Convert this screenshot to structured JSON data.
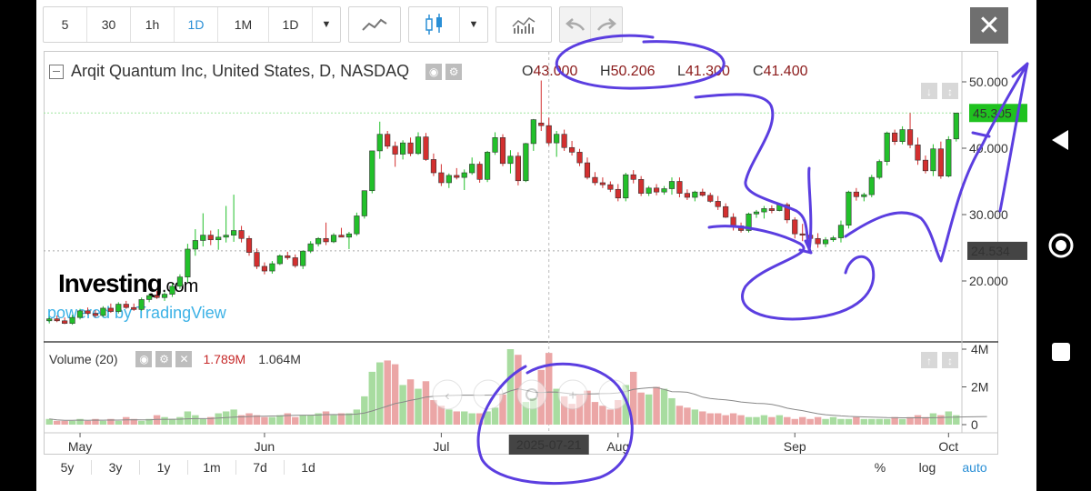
{
  "toolbar": {
    "intervals": [
      "5",
      "30",
      "1h",
      "1D",
      "1M",
      "1D"
    ],
    "active_interval": "1D"
  },
  "header": {
    "title": "Arqit Quantum Inc, United States, D, NASDAQ",
    "o_label": "O",
    "o_value": "43.000",
    "h_label": "H",
    "h_value": "50.206",
    "l_label": "L",
    "l_value": "41.300",
    "c_label": "C",
    "c_value": "41.400"
  },
  "volume_legend": {
    "title": "Volume (20)",
    "value1": "1.789M",
    "value2": "1.064M"
  },
  "watermark": {
    "logo": "Investing",
    "logo_suffix": ".com",
    "powered": "powered by TradingView"
  },
  "crosshair_date": "2025-07-21",
  "bottom_ranges": [
    "5y",
    "3y",
    "1y",
    "1m",
    "7d",
    "1d"
  ],
  "bottom_right": [
    "%",
    "log",
    "auto"
  ],
  "colors": {
    "up": "#22c02a",
    "down": "#d32f2f",
    "up_volume": "#a8dca0",
    "down_volume": "#eba6a6",
    "last_price_label": "#1fc21f",
    "marker_label": "#444444",
    "annotation": "#5b3ee0"
  },
  "chart_data": {
    "type": "candlestick",
    "y_axis": {
      "range": [
        10,
        55
      ],
      "ticks": [
        "50.000",
        "40.000",
        "30.000",
        "20.000"
      ],
      "tick_values": [
        50,
        40,
        30,
        20
      ]
    },
    "volume_axis": {
      "ticks": [
        "4M",
        "2M",
        "0"
      ],
      "tick_values": [
        4,
        2,
        0
      ],
      "unit": "M"
    },
    "x_ticks": [
      "May",
      "Jun",
      "Jul",
      "Aug",
      "Sep",
      "Oct"
    ],
    "last_price": "45.305",
    "last_value": 45.305,
    "marker_price": "24.534",
    "marker_value": 24.534,
    "candles": [
      {
        "o": 14.0,
        "h": 14.6,
        "l": 13.6,
        "c": 14.3
      },
      {
        "o": 14.3,
        "h": 14.8,
        "l": 13.8,
        "c": 14.0
      },
      {
        "o": 14.0,
        "h": 14.5,
        "l": 13.5,
        "c": 13.6
      },
      {
        "o": 13.6,
        "h": 14.9,
        "l": 13.4,
        "c": 14.5
      },
      {
        "o": 14.5,
        "h": 15.8,
        "l": 14.2,
        "c": 15.5
      },
      {
        "o": 15.5,
        "h": 16.0,
        "l": 14.9,
        "c": 15.1
      },
      {
        "o": 15.1,
        "h": 15.6,
        "l": 14.5,
        "c": 14.8
      },
      {
        "o": 14.8,
        "h": 16.2,
        "l": 14.6,
        "c": 15.9
      },
      {
        "o": 15.9,
        "h": 16.6,
        "l": 15.2,
        "c": 15.4
      },
      {
        "o": 15.4,
        "h": 16.8,
        "l": 15.1,
        "c": 16.5
      },
      {
        "o": 16.5,
        "h": 17.0,
        "l": 15.8,
        "c": 16.0
      },
      {
        "o": 16.0,
        "h": 16.6,
        "l": 15.5,
        "c": 15.7
      },
      {
        "o": 15.7,
        "h": 17.5,
        "l": 15.5,
        "c": 17.2
      },
      {
        "o": 17.2,
        "h": 18.0,
        "l": 16.8,
        "c": 17.8
      },
      {
        "o": 17.8,
        "h": 18.5,
        "l": 17.3,
        "c": 17.5
      },
      {
        "o": 17.5,
        "h": 18.3,
        "l": 17.0,
        "c": 18.0
      },
      {
        "o": 18.0,
        "h": 19.6,
        "l": 17.6,
        "c": 19.2
      },
      {
        "o": 19.2,
        "h": 21.0,
        "l": 18.8,
        "c": 20.6
      },
      {
        "o": 20.6,
        "h": 25.6,
        "l": 19.8,
        "c": 24.8
      },
      {
        "o": 24.8,
        "h": 27.8,
        "l": 23.8,
        "c": 26.1
      },
      {
        "o": 26.1,
        "h": 30.2,
        "l": 25.2,
        "c": 26.9
      },
      {
        "o": 26.9,
        "h": 27.6,
        "l": 25.4,
        "c": 26.2
      },
      {
        "o": 26.2,
        "h": 27.8,
        "l": 24.7,
        "c": 26.6
      },
      {
        "o": 26.6,
        "h": 31.3,
        "l": 25.8,
        "c": 26.9
      },
      {
        "o": 26.9,
        "h": 33.0,
        "l": 25.9,
        "c": 27.6
      },
      {
        "o": 27.6,
        "h": 28.3,
        "l": 25.8,
        "c": 26.4
      },
      {
        "o": 26.4,
        "h": 26.8,
        "l": 23.8,
        "c": 24.3
      },
      {
        "o": 24.3,
        "h": 24.9,
        "l": 21.8,
        "c": 22.2
      },
      {
        "o": 22.2,
        "h": 22.8,
        "l": 21.0,
        "c": 21.5
      },
      {
        "o": 21.5,
        "h": 23.0,
        "l": 21.1,
        "c": 22.6
      },
      {
        "o": 22.6,
        "h": 24.0,
        "l": 22.4,
        "c": 23.8
      },
      {
        "o": 23.8,
        "h": 24.4,
        "l": 23.2,
        "c": 23.5
      },
      {
        "o": 23.5,
        "h": 24.0,
        "l": 22.0,
        "c": 22.3
      },
      {
        "o": 22.3,
        "h": 24.6,
        "l": 21.8,
        "c": 24.5
      },
      {
        "o": 24.5,
        "h": 26.0,
        "l": 24.2,
        "c": 25.6
      },
      {
        "o": 25.6,
        "h": 26.6,
        "l": 25.2,
        "c": 26.4
      },
      {
        "o": 26.4,
        "h": 28.8,
        "l": 25.4,
        "c": 25.9
      },
      {
        "o": 25.9,
        "h": 27.2,
        "l": 25.7,
        "c": 26.9
      },
      {
        "o": 26.9,
        "h": 28.0,
        "l": 26.6,
        "c": 26.6
      },
      {
        "o": 26.6,
        "h": 27.4,
        "l": 24.8,
        "c": 27.1
      },
      {
        "o": 27.1,
        "h": 30.3,
        "l": 26.8,
        "c": 29.8
      },
      {
        "o": 29.8,
        "h": 33.6,
        "l": 29.4,
        "c": 33.6
      },
      {
        "o": 33.6,
        "h": 39.6,
        "l": 33.2,
        "c": 39.6
      },
      {
        "o": 39.6,
        "h": 44.0,
        "l": 38.4,
        "c": 42.1
      },
      {
        "o": 42.1,
        "h": 42.6,
        "l": 39.9,
        "c": 40.3
      },
      {
        "o": 40.3,
        "h": 41.0,
        "l": 37.2,
        "c": 39.1
      },
      {
        "o": 39.1,
        "h": 41.2,
        "l": 38.3,
        "c": 40.8
      },
      {
        "o": 40.8,
        "h": 41.6,
        "l": 38.8,
        "c": 39.2
      },
      {
        "o": 39.2,
        "h": 42.4,
        "l": 39.0,
        "c": 41.7
      },
      {
        "o": 41.7,
        "h": 42.3,
        "l": 38.1,
        "c": 38.3
      },
      {
        "o": 38.3,
        "h": 39.2,
        "l": 35.8,
        "c": 36.3
      },
      {
        "o": 36.3,
        "h": 37.6,
        "l": 34.3,
        "c": 34.8
      },
      {
        "o": 34.8,
        "h": 36.2,
        "l": 34.0,
        "c": 35.9
      },
      {
        "o": 35.9,
        "h": 37.0,
        "l": 35.3,
        "c": 35.6
      },
      {
        "o": 35.6,
        "h": 36.8,
        "l": 33.7,
        "c": 36.3
      },
      {
        "o": 36.3,
        "h": 38.6,
        "l": 36.0,
        "c": 37.6
      },
      {
        "o": 37.6,
        "h": 38.0,
        "l": 34.8,
        "c": 35.3
      },
      {
        "o": 35.3,
        "h": 39.6,
        "l": 34.9,
        "c": 39.4
      },
      {
        "o": 39.4,
        "h": 42.4,
        "l": 39.0,
        "c": 41.6
      },
      {
        "o": 41.6,
        "h": 42.1,
        "l": 37.3,
        "c": 37.7
      },
      {
        "o": 37.7,
        "h": 39.7,
        "l": 36.2,
        "c": 38.8
      },
      {
        "o": 38.8,
        "h": 39.4,
        "l": 34.4,
        "c": 35.1
      },
      {
        "o": 35.1,
        "h": 40.8,
        "l": 34.9,
        "c": 40.7
      },
      {
        "o": 40.7,
        "h": 44.4,
        "l": 39.6,
        "c": 44.3
      },
      {
        "o": 43.8,
        "h": 50.2,
        "l": 42.6,
        "c": 43.4
      },
      {
        "o": 43.4,
        "h": 44.6,
        "l": 40.4,
        "c": 40.8
      },
      {
        "o": 40.8,
        "h": 42.6,
        "l": 38.7,
        "c": 42.1
      },
      {
        "o": 42.1,
        "h": 42.8,
        "l": 39.6,
        "c": 40.1
      },
      {
        "o": 40.1,
        "h": 41.1,
        "l": 38.9,
        "c": 39.4
      },
      {
        "o": 39.4,
        "h": 39.9,
        "l": 37.3,
        "c": 37.8
      },
      {
        "o": 37.8,
        "h": 38.6,
        "l": 35.3,
        "c": 35.6
      },
      {
        "o": 35.6,
        "h": 36.4,
        "l": 34.4,
        "c": 34.8
      },
      {
        "o": 34.8,
        "h": 35.6,
        "l": 34.0,
        "c": 34.5
      },
      {
        "o": 34.5,
        "h": 35.0,
        "l": 33.4,
        "c": 33.8
      },
      {
        "o": 33.8,
        "h": 34.6,
        "l": 32.0,
        "c": 32.5
      },
      {
        "o": 32.5,
        "h": 36.3,
        "l": 32.0,
        "c": 36.0
      },
      {
        "o": 36.0,
        "h": 36.7,
        "l": 34.7,
        "c": 35.3
      },
      {
        "o": 35.3,
        "h": 35.8,
        "l": 32.8,
        "c": 33.2
      },
      {
        "o": 33.2,
        "h": 34.3,
        "l": 32.8,
        "c": 34.0
      },
      {
        "o": 34.0,
        "h": 34.6,
        "l": 32.9,
        "c": 33.4
      },
      {
        "o": 33.4,
        "h": 34.3,
        "l": 33.0,
        "c": 33.9
      },
      {
        "o": 33.9,
        "h": 35.6,
        "l": 33.0,
        "c": 35.0
      },
      {
        "o": 35.0,
        "h": 35.6,
        "l": 32.6,
        "c": 33.2
      },
      {
        "o": 33.2,
        "h": 33.8,
        "l": 32.2,
        "c": 32.6
      },
      {
        "o": 32.6,
        "h": 33.6,
        "l": 32.0,
        "c": 33.4
      },
      {
        "o": 33.4,
        "h": 33.9,
        "l": 32.7,
        "c": 32.9
      },
      {
        "o": 32.9,
        "h": 33.3,
        "l": 31.8,
        "c": 32.0
      },
      {
        "o": 32.0,
        "h": 32.8,
        "l": 30.7,
        "c": 31.2
      },
      {
        "o": 31.2,
        "h": 31.7,
        "l": 29.5,
        "c": 29.6
      },
      {
        "o": 29.6,
        "h": 30.2,
        "l": 27.6,
        "c": 28.3
      },
      {
        "o": 28.3,
        "h": 28.8,
        "l": 27.3,
        "c": 27.6
      },
      {
        "o": 27.6,
        "h": 30.3,
        "l": 27.3,
        "c": 30.1
      },
      {
        "o": 30.1,
        "h": 30.7,
        "l": 29.5,
        "c": 30.4
      },
      {
        "o": 30.4,
        "h": 31.3,
        "l": 29.4,
        "c": 30.9
      },
      {
        "o": 30.9,
        "h": 31.4,
        "l": 30.2,
        "c": 30.6
      },
      {
        "o": 30.6,
        "h": 31.7,
        "l": 30.5,
        "c": 31.5
      },
      {
        "o": 31.5,
        "h": 31.8,
        "l": 28.7,
        "c": 29.2
      },
      {
        "o": 29.2,
        "h": 29.6,
        "l": 26.4,
        "c": 27.1
      },
      {
        "o": 27.1,
        "h": 28.6,
        "l": 26.0,
        "c": 26.9
      },
      {
        "o": 26.9,
        "h": 27.3,
        "l": 26.0,
        "c": 26.4
      },
      {
        "o": 26.4,
        "h": 27.2,
        "l": 25.0,
        "c": 25.6
      },
      {
        "o": 25.6,
        "h": 26.6,
        "l": 25.1,
        "c": 26.2
      },
      {
        "o": 26.2,
        "h": 26.8,
        "l": 25.9,
        "c": 26.5
      },
      {
        "o": 26.5,
        "h": 29.1,
        "l": 25.8,
        "c": 28.4
      },
      {
        "o": 28.4,
        "h": 33.6,
        "l": 27.9,
        "c": 33.4
      },
      {
        "o": 33.4,
        "h": 34.0,
        "l": 32.1,
        "c": 32.7
      },
      {
        "o": 32.7,
        "h": 33.3,
        "l": 32.0,
        "c": 33.0
      },
      {
        "o": 33.0,
        "h": 36.0,
        "l": 32.6,
        "c": 35.6
      },
      {
        "o": 35.6,
        "h": 38.3,
        "l": 35.3,
        "c": 38.0
      },
      {
        "o": 38.0,
        "h": 42.5,
        "l": 37.4,
        "c": 42.3
      },
      {
        "o": 42.3,
        "h": 42.8,
        "l": 40.5,
        "c": 41.0
      },
      {
        "o": 41.0,
        "h": 43.3,
        "l": 40.6,
        "c": 42.8
      },
      {
        "o": 42.8,
        "h": 45.3,
        "l": 40.0,
        "c": 40.5
      },
      {
        "o": 40.5,
        "h": 41.6,
        "l": 37.5,
        "c": 38.2
      },
      {
        "o": 38.2,
        "h": 38.9,
        "l": 36.2,
        "c": 36.6
      },
      {
        "o": 36.6,
        "h": 40.6,
        "l": 35.8,
        "c": 39.9
      },
      {
        "o": 39.9,
        "h": 41.0,
        "l": 35.4,
        "c": 35.8
      },
      {
        "o": 35.8,
        "h": 41.8,
        "l": 35.6,
        "c": 41.3
      },
      {
        "o": 41.4,
        "h": 45.305,
        "l": 41.0,
        "c": 45.305
      }
    ],
    "volume_m": [
      0.3,
      0.2,
      0.2,
      0.2,
      0.3,
      0.2,
      0.3,
      0.2,
      0.3,
      0.2,
      0.4,
      0.3,
      0.2,
      0.3,
      0.5,
      0.4,
      0.3,
      0.4,
      0.7,
      0.5,
      0.3,
      0.4,
      0.6,
      0.7,
      0.8,
      0.5,
      0.6,
      0.5,
      0.4,
      0.4,
      0.5,
      0.6,
      0.4,
      0.5,
      0.5,
      0.6,
      0.7,
      0.5,
      0.6,
      0.6,
      0.8,
      1.5,
      2.8,
      3.3,
      3.4,
      3.2,
      2.1,
      2.4,
      1.9,
      2.3,
      1.3,
      1.0,
      0.8,
      0.7,
      0.7,
      0.6,
      0.6,
      0.7,
      0.9,
      1.6,
      4.0,
      3.7,
      1.2,
      1.4,
      2.9,
      3.8,
      1.9,
      1.5,
      1.1,
      1.6,
      1.8,
      1.2,
      1.0,
      0.8,
      1.3,
      2.1,
      2.8,
      1.7,
      1.6,
      2.0,
      1.9,
      1.4,
      1.0,
      0.9,
      0.8,
      0.7,
      0.6,
      0.6,
      0.5,
      0.6,
      0.5,
      0.4,
      0.4,
      0.5,
      0.4,
      0.5,
      0.4,
      0.3,
      0.4,
      0.3,
      0.4,
      0.3,
      0.4,
      0.3,
      0.3,
      0.4,
      0.3,
      0.3,
      0.3,
      0.3,
      0.4,
      0.3,
      0.4,
      0.5,
      0.4,
      0.6,
      0.5,
      0.7,
      0.5,
      0.6,
      0.5,
      0.5,
      0.5
    ]
  }
}
